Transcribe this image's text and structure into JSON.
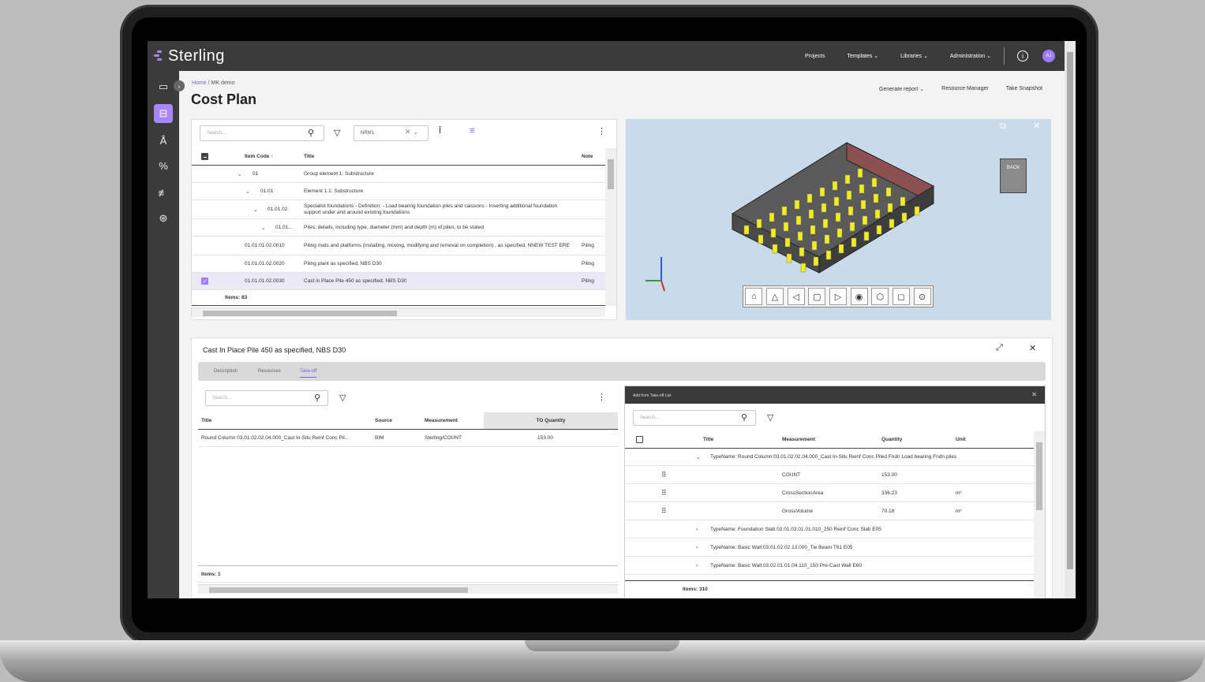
{
  "app": {
    "brand": "Sterling",
    "nav": {
      "projects": "Projects",
      "templates": "Templates ⌄",
      "libraries": "Libraries ⌄",
      "administration": "Administration ⌄",
      "avatar_initials": "AJ"
    },
    "accent_color": "#a787ff"
  },
  "page": {
    "breadcrumb_home": "Home",
    "breadcrumb_sep": "/",
    "breadcrumb_current": "MK demo",
    "title": "Cost Plan",
    "actions": {
      "generate_report": "Generate report ⌄",
      "resource_manager": "Resource Manager",
      "take_snapshot": "Take Snapshot"
    }
  },
  "cost_table": {
    "search_placeholder": "Search...",
    "filter_value": "NRM1",
    "headers": {
      "item_code": "Item Code ↑",
      "title": "Title",
      "note": "Note"
    },
    "rows": [
      {
        "code": "01",
        "title": "Group element 1: Substructure",
        "note": ""
      },
      {
        "code": "01.01",
        "title": "Element 1.1: Substructure",
        "note": ""
      },
      {
        "code": "01.01.02",
        "title": "Specialist foundations - Definition: - Load bearing foundation piles and caissons - Inserting additional foundation support under and around existing foundations",
        "note": ""
      },
      {
        "code": "01.01...",
        "title": "Piles: details, including type, diameter (mm) and depth (m) of piles, to be stated",
        "note": ""
      },
      {
        "code": "01.01.01.02.0010",
        "title": "Piling mats and platforms (installing, moving, modifying and removal on completion) , as specified, NNEW TEST ERE",
        "note": "Piling"
      },
      {
        "code": "01.01.01.02.0020",
        "title": "Piling plant as specified, NBS D30",
        "note": "Piling"
      },
      {
        "code": "01.01.01.02.0030",
        "title": "Cast in Place Pile 450 as specified, NBS D30",
        "note": "Piling"
      }
    ],
    "items_count": "Items: 83"
  },
  "viewer": {
    "viewcube_label": "BACK",
    "tools": [
      "home-icon",
      "perspective-icon",
      "orbit-icon",
      "box-icon",
      "select-icon",
      "eye-icon",
      "section-icon",
      "cube-icon",
      "camera-icon"
    ]
  },
  "detail": {
    "title": "Cast In Place Pile 450 as specified, NBS D30",
    "tabs": {
      "description": "Description",
      "resources": "Resources",
      "takeoff": "Take-off"
    },
    "search_placeholder": "Search...",
    "headers": {
      "title": "Title",
      "source": "Source",
      "measurement": "Measurement",
      "quantity": "TO Quantity"
    },
    "rows": [
      {
        "title": "Round Column 03.01.02.02.04.000_Cast In-Situ Reinf Conc Pil...",
        "source": "BIM",
        "measurement": "Sterling/COUNT",
        "quantity": "153.00"
      }
    ],
    "items_count": "Items: 1"
  },
  "popup": {
    "title": "Add from Take-off List",
    "search_placeholder": "Search...",
    "headers": {
      "title": "Title",
      "measurement": "Measurement",
      "quantity": "Quantity",
      "unit": "Unit"
    },
    "group_open": "TypeName: Round Column:03.01.02.02.04.000_Cast In-Situ Reinf Conc Piled Fndn Load bearing Fndn piles",
    "measures": [
      {
        "measurement": "COUNT",
        "quantity": "153.00",
        "unit": ""
      },
      {
        "measurement": "CrossSectionArea",
        "quantity": "336.23",
        "unit": "m²"
      },
      {
        "measurement": "GrossVolume",
        "quantity": "70.18",
        "unit": "m³"
      }
    ],
    "groups_closed": [
      "TypeName: Foundation Slab:03.01.03.01.01.010_250 Reinf Conc Slab E05",
      "TypeName: Basic Wall:03.01.02.02.13.000_Tie Beam T61 E05",
      "TypeName: Basic Wall:03.02.01.01.04.110_150 Pre-Cast Wall E60"
    ],
    "items_count": "Items: 310"
  }
}
